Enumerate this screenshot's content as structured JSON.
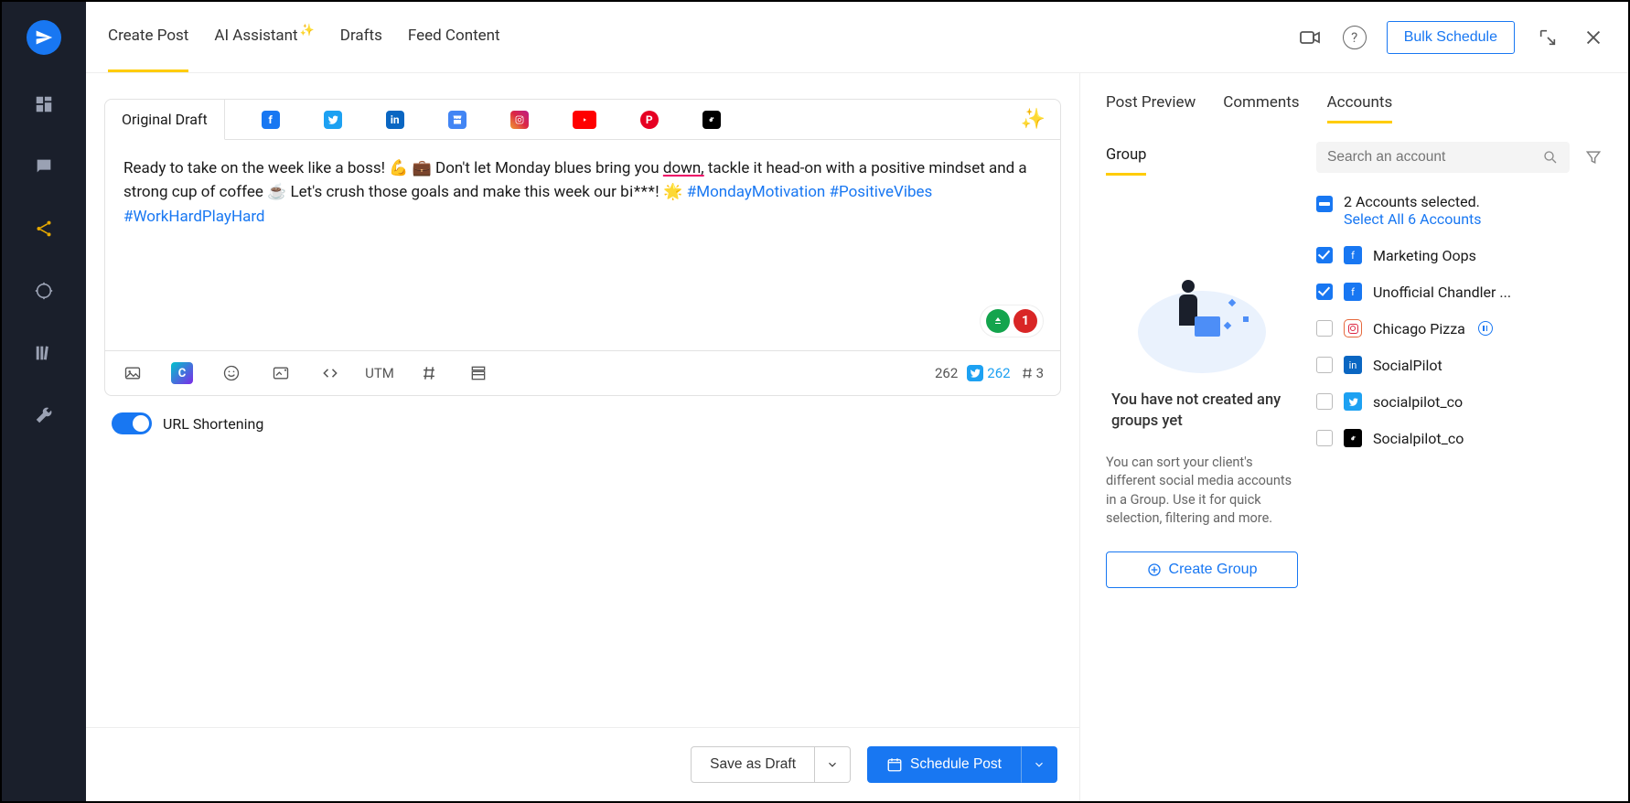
{
  "topbar": {
    "tabs": [
      "Create Post",
      "AI Assistant",
      "Drafts",
      "Feed Content"
    ],
    "bulk_schedule": "Bulk Schedule"
  },
  "composer": {
    "original_draft_label": "Original Draft",
    "post_text_plain": "Ready to take on the week like a boss! 💪 💼 Don't let Monday blues bring you ",
    "post_text_down": "down,",
    "post_text_mid": " tackle it head-on with a positive mindset and a strong cup of coffee ☕  Let's crush those goals and make this week our ",
    "post_text_bleep": "bi***!",
    "post_text_end": " 🌟 ",
    "hashtags": [
      "#MondayMotivation",
      "#PositiveVibes",
      "#WorkHardPlayHard"
    ],
    "error_count": "1",
    "char_count": "262",
    "tw_count": "262",
    "hash_count": "3",
    "utm_label": "UTM"
  },
  "url_shortening_label": "URL Shortening",
  "actions": {
    "save_draft": "Save as Draft",
    "schedule_post": "Schedule Post"
  },
  "right": {
    "tabs": [
      "Post Preview",
      "Comments",
      "Accounts"
    ],
    "group_tab": "Group",
    "group_empty_title": "You have not created any groups yet",
    "group_empty_desc": "You can sort your client's different social media accounts in a Group. Use it for quick selection, filtering and more.",
    "create_group": "Create Group",
    "search_placeholder": "Search an account",
    "selected_summary": "2 Accounts selected.",
    "select_all": "Select All 6 Accounts",
    "accounts": [
      {
        "name": "Marketing Oops",
        "platform": "fb",
        "checked": true,
        "paused": false
      },
      {
        "name": "Unofficial Chandler ...",
        "platform": "fb",
        "checked": true,
        "paused": false
      },
      {
        "name": "Chicago Pizza",
        "platform": "ig",
        "checked": false,
        "paused": true
      },
      {
        "name": "SocialPilot",
        "platform": "li",
        "checked": false,
        "paused": false
      },
      {
        "name": "socialpilot_co",
        "platform": "tw",
        "checked": false,
        "paused": false
      },
      {
        "name": "Socialpilot_co",
        "platform": "tk",
        "checked": false,
        "paused": false
      }
    ]
  }
}
